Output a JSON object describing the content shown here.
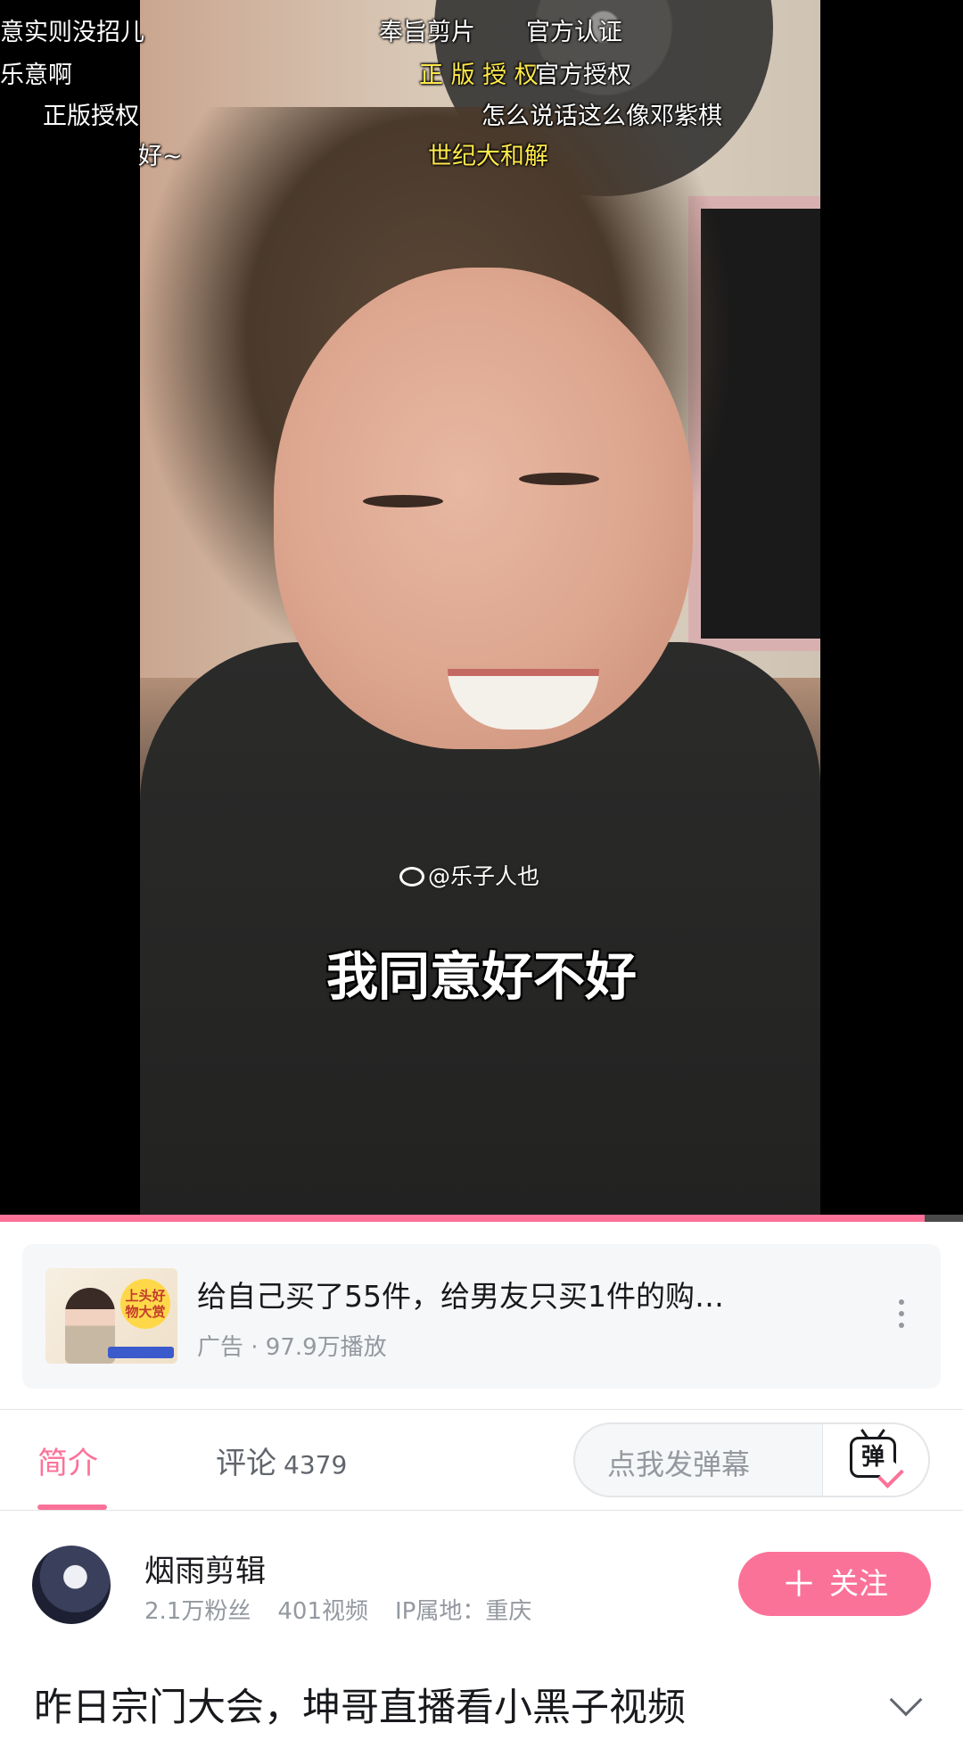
{
  "player": {
    "danmaku": [
      {
        "text": "意实则没招儿",
        "color": "white"
      },
      {
        "text": "乐意啊",
        "color": "white"
      },
      {
        "text": "正版授权",
        "color": "white"
      },
      {
        "text": "好~",
        "color": "white"
      },
      {
        "text": "奉旨剪片",
        "color": "white"
      },
      {
        "text": "官方认证",
        "color": "white"
      },
      {
        "text": "正 版 授 权",
        "color": "yellow"
      },
      {
        "text": "官方授权",
        "color": "white"
      },
      {
        "text": "怎么说话这么像邓紫棋",
        "color": "white"
      },
      {
        "text": "世纪大和解",
        "color": "yellow"
      }
    ],
    "watermark": "@乐子人也",
    "subtitle": "我同意好不好",
    "progress_fraction": 0.96
  },
  "ad": {
    "title": "给自己买了55件，给男友只买1件的购…",
    "meta": "广告 · 97.9万播放",
    "thumb_text": "上头好物大赏"
  },
  "tabs": {
    "intro": "简介",
    "comments": "评论",
    "comment_count": "4379",
    "danmaku_placeholder": "点我发弹幕",
    "danmaku_icon_text": "弹"
  },
  "uploader": {
    "name": "烟雨剪辑",
    "fans": "2.1万粉丝",
    "videos": "401视频",
    "ip": "IP属地：重庆",
    "follow_label": "关注",
    "follow_plus": "＋"
  },
  "video": {
    "title": "昨日宗门大会，坤哥直播看小黑子视频"
  },
  "colors": {
    "accent": "#fb7299",
    "danmaku_yellow": "#ffe94a",
    "secondary_text": "#9499a0"
  }
}
